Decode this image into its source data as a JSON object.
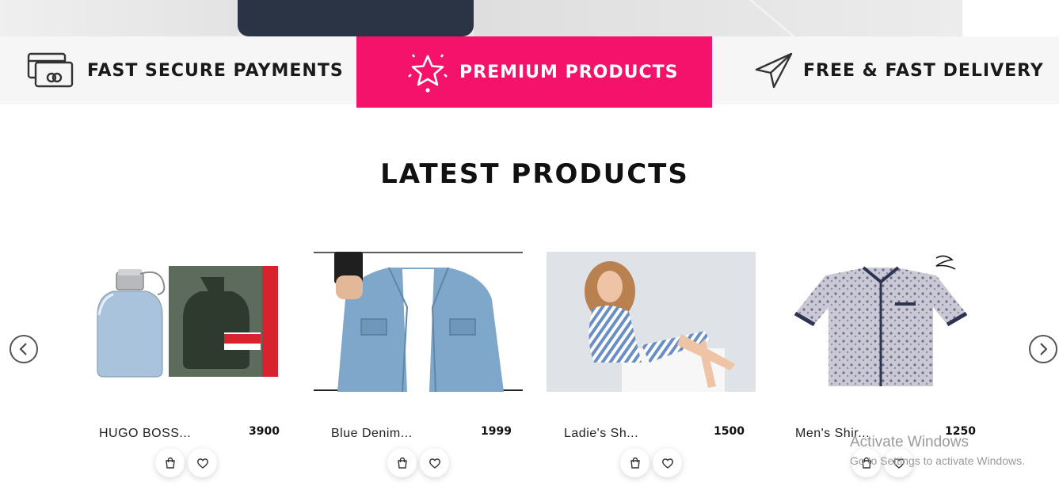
{
  "features": [
    {
      "label": "FAST SECURE PAYMENTS",
      "icon": "credit-card-icon"
    },
    {
      "label": "PREMIUM PRODUCTS",
      "icon": "star-icon"
    },
    {
      "label": "FREE & FAST DELIVERY",
      "icon": "paper-plane-icon"
    }
  ],
  "section": {
    "title": "LATEST PRODUCTS"
  },
  "carousel": {
    "prev_icon": "chevron-left-icon",
    "next_icon": "chevron-right-icon"
  },
  "products": [
    {
      "name": "HUGO BOSS...",
      "price": "3900"
    },
    {
      "name": "Blue Denim...",
      "price": "1999"
    },
    {
      "name": "Ladie's Sh...",
      "price": "1500"
    },
    {
      "name": "Men's Shir...",
      "price": "1250"
    }
  ],
  "colors": {
    "accent": "#f5126a",
    "strip_bg": "#f6f6f6"
  },
  "watermark": {
    "title": "Activate Windows",
    "subtitle": "Go to Settings to activate Windows."
  }
}
